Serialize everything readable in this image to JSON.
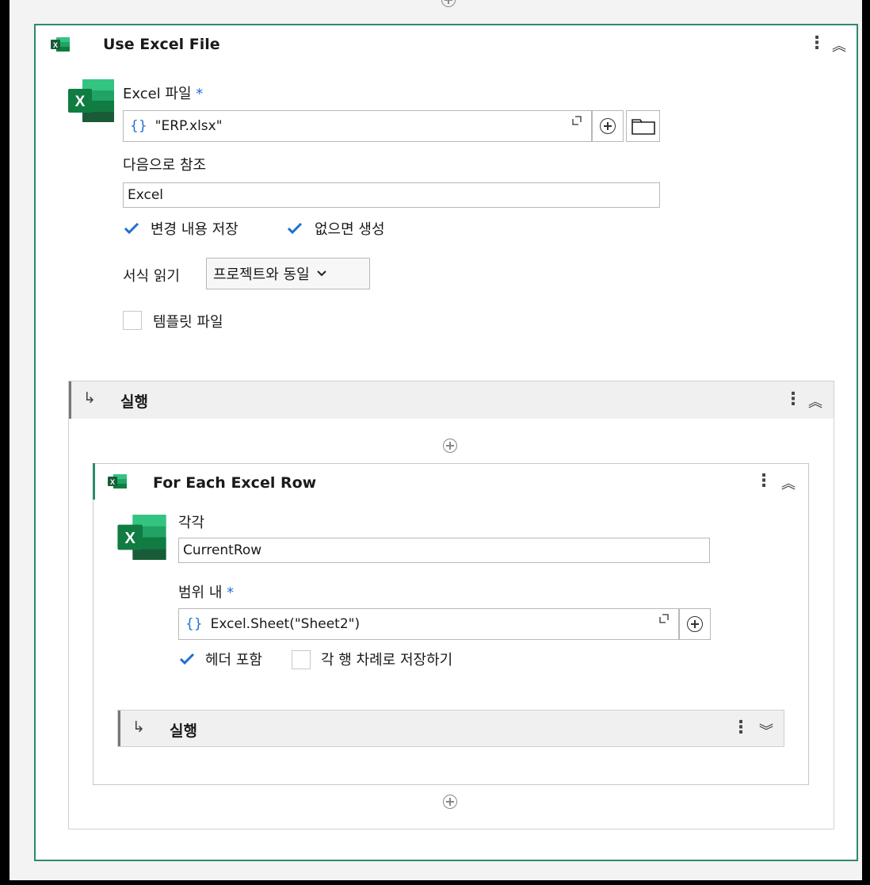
{
  "use_excel_file": {
    "title": "Use Excel File",
    "excel_file_label": "Excel 파일",
    "required_mark": "*",
    "excel_file_value": "\"ERP.xlsx\"",
    "reference_as_label": "다음으로 참조",
    "reference_as_value": "Excel",
    "save_changes_label": "변경 내용 저장",
    "save_changes_checked": true,
    "create_if_missing_label": "없으면 생성",
    "create_if_missing_checked": true,
    "read_formatting_label": "서식 읽기",
    "read_formatting_value": "프로젝트와 동일",
    "template_file_label": "템플릿 파일",
    "template_file_checked": false
  },
  "do_sequence": {
    "title": "실행"
  },
  "for_each_row": {
    "title": "For Each Excel Row",
    "each_label": "각각",
    "each_value": "CurrentRow",
    "in_range_label": "범위 내",
    "in_range_value": "Excel.Sheet(\"Sheet2\")",
    "has_headers_label": "헤더 포함",
    "has_headers_checked": true,
    "save_after_each_row_label": "각 행 차례로 저장하기",
    "save_after_each_row_checked": false
  },
  "inner_do": {
    "title": "실행"
  },
  "icons": {
    "brace": "{}",
    "expand": "expand-icon",
    "kebab": "⋮",
    "collapse": "︽",
    "expand_chevron": "︾",
    "branch_arrow": "↳"
  },
  "colors": {
    "accent": "#2d8a6a",
    "excel_green": "#1d6f42",
    "blue": "#1f6fd1"
  }
}
